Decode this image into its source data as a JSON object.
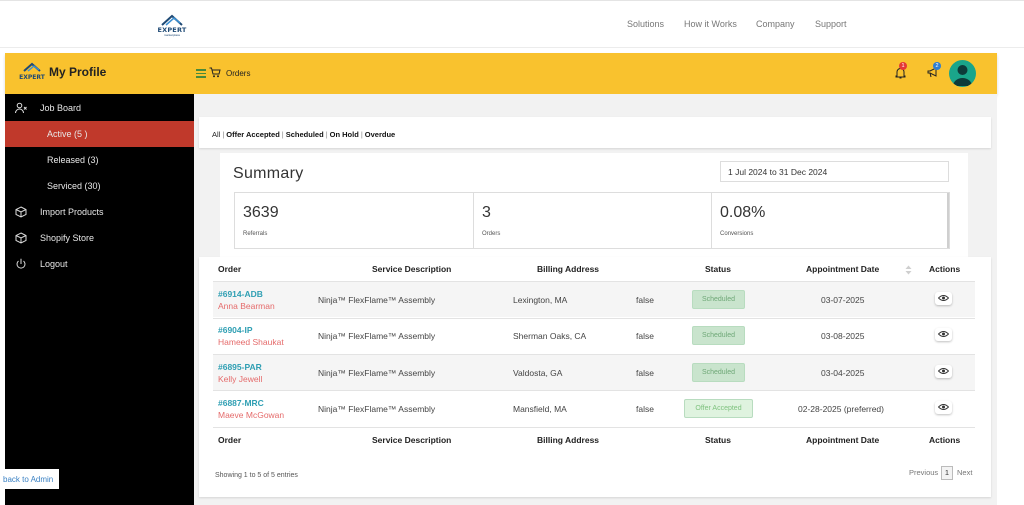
{
  "topnav": {
    "brand": "EXPERT",
    "brand_sub": "marketplace",
    "links": [
      "Solutions",
      "How it Works",
      "Company",
      "Support"
    ]
  },
  "header": {
    "title": "My Profile",
    "section_label": "Orders",
    "notifications_count": "1",
    "announcements_count": "2",
    "accent_color": "#f9c22e"
  },
  "sidebar": {
    "items": [
      {
        "label": "Job Board",
        "icon": "user-x-icon"
      },
      {
        "label": "Active (5 )",
        "active": true
      },
      {
        "label": "Released (3)"
      },
      {
        "label": "Serviced (30)"
      },
      {
        "label": "Import Products",
        "icon": "box-icon"
      },
      {
        "label": "Shopify Store",
        "icon": "box-icon"
      },
      {
        "label": "Logout",
        "icon": "power-icon"
      }
    ],
    "back_to_admin": "back to Admin"
  },
  "filters": {
    "all": "All",
    "items": [
      "Offer Accepted",
      "Scheduled",
      "On Hold",
      "Overdue"
    ]
  },
  "summary": {
    "title": "Summary",
    "date_range": "1 Jul 2024 to 31 Dec 2024",
    "stats": [
      {
        "value": "3639",
        "label": "Referrals"
      },
      {
        "value": "3",
        "label": "Orders"
      },
      {
        "value": "0.08%",
        "label": "Conversions"
      }
    ]
  },
  "table": {
    "columns": [
      "Order",
      "Service Description",
      "Billing Address",
      "Status",
      "Appointment Date",
      "Actions"
    ],
    "rows": [
      {
        "id": "#6914-ADB",
        "name": "Anna Bearman",
        "service": "Ninja™ FlexFlame™ Assembly",
        "address": "Lexington, MA",
        "flag": "false",
        "status": "Scheduled",
        "date": "03-07-2025"
      },
      {
        "id": "#6904-IP",
        "name": "Hameed Shaukat",
        "service": "Ninja™ FlexFlame™ Assembly",
        "address": "Sherman Oaks, CA",
        "flag": "false",
        "status": "Scheduled",
        "date": "03-08-2025"
      },
      {
        "id": "#6895-PAR",
        "name": "Kelly Jewell",
        "service": "Ninja™ FlexFlame™ Assembly",
        "address": "Valdosta, GA",
        "flag": "false",
        "status": "Scheduled",
        "date": "03-04-2025"
      },
      {
        "id": "#6887-MRC",
        "name": "Maeve McGowan",
        "service": "Ninja™ FlexFlame™ Assembly",
        "address": "Mansfield, MA",
        "flag": "false",
        "status": "Offer Accepted",
        "date": "02-28-2025 (preferred)"
      }
    ],
    "showing": "Showing 1 to 5 of 5 entries",
    "pager": {
      "previous": "Previous",
      "current": "1",
      "next": "Next"
    }
  }
}
